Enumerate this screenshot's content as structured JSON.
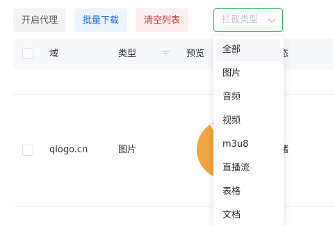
{
  "toolbar": {
    "proxy_label": "开启代理",
    "download_label": "批量下载",
    "clear_label": "清空列表"
  },
  "type_select": {
    "placeholder": "拦截类型",
    "options": [
      "全部",
      "图片",
      "音频",
      "视频",
      "m3u8",
      "直播流",
      "表格",
      "文档"
    ],
    "hovered": "全部"
  },
  "table": {
    "headers": {
      "domain": "域",
      "type": "类型",
      "preview": "预览",
      "status_partial": "态"
    },
    "rows": [
      {
        "domain": "qlogo.cn",
        "type": "图片",
        "status_partial": "绪"
      }
    ]
  },
  "colors": {
    "select_border": "#2fb85c",
    "download_text": "#1f6fe0",
    "clear_text": "#d93a3a",
    "preview_fill": "#f2a541"
  },
  "icons": [
    "chevron-down-icon",
    "filter-icon"
  ]
}
